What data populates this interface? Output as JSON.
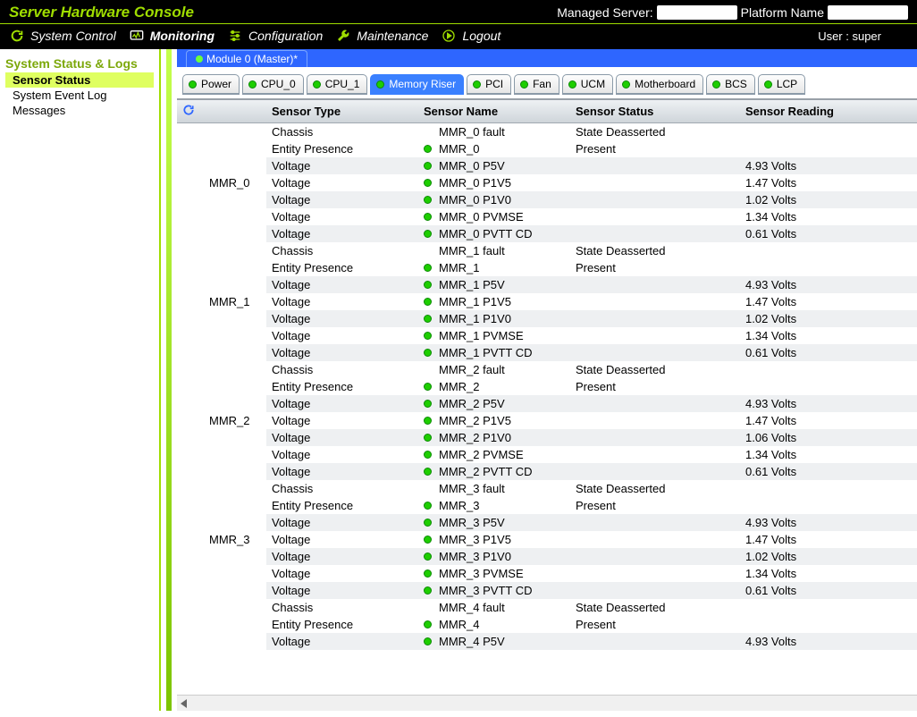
{
  "header": {
    "title": "Server Hardware Console",
    "managed_server_label": "Managed Server:",
    "platform_name_label": "Platform Name"
  },
  "menubar": {
    "items": [
      {
        "label": "System Control",
        "icon": "refresh-icon"
      },
      {
        "label": "Monitoring",
        "icon": "monitor-icon",
        "active": true
      },
      {
        "label": "Configuration",
        "icon": "sliders-icon"
      },
      {
        "label": "Maintenance",
        "icon": "wrench-icon"
      },
      {
        "label": "Logout",
        "icon": "logout-icon"
      }
    ],
    "user_label": "User : super"
  },
  "sidebar": {
    "section_title": "System Status & Logs",
    "items": [
      {
        "label": "Sensor Status",
        "selected": true
      },
      {
        "label": "System Event Log"
      },
      {
        "label": "Messages"
      }
    ]
  },
  "module_tab": "Module 0 (Master)*",
  "category_tabs": [
    {
      "label": "Power"
    },
    {
      "label": "CPU_0"
    },
    {
      "label": "CPU_1"
    },
    {
      "label": "Memory Riser",
      "active": true
    },
    {
      "label": "PCI"
    },
    {
      "label": "Fan"
    },
    {
      "label": "UCM"
    },
    {
      "label": "Motherboard"
    },
    {
      "label": "BCS"
    },
    {
      "label": "LCP"
    }
  ],
  "columns": {
    "c0": "",
    "c1": "Sensor Type",
    "c2": "Sensor Name",
    "c3": "Sensor Status",
    "c4": "Sensor Reading"
  },
  "groups": [
    {
      "name": "MMR_0",
      "rows": [
        {
          "type": "Chassis",
          "name": "MMR_0 fault",
          "status": "State Deasserted",
          "reading": "",
          "led": false,
          "stripe": false
        },
        {
          "type": "Entity Presence",
          "name": "MMR_0",
          "status": "Present",
          "reading": "",
          "led": true,
          "stripe": false
        },
        {
          "type": "Voltage",
          "name": "MMR_0 P5V",
          "status": "",
          "reading": "4.93 Volts",
          "led": true,
          "stripe": true
        },
        {
          "type": "Voltage",
          "name": "MMR_0 P1V5",
          "status": "",
          "reading": "1.47 Volts",
          "led": true,
          "stripe": false
        },
        {
          "type": "Voltage",
          "name": "MMR_0 P1V0",
          "status": "",
          "reading": "1.02 Volts",
          "led": true,
          "stripe": true
        },
        {
          "type": "Voltage",
          "name": "MMR_0 PVMSE",
          "status": "",
          "reading": "1.34 Volts",
          "led": true,
          "stripe": false
        },
        {
          "type": "Voltage",
          "name": "MMR_0 PVTT CD",
          "status": "",
          "reading": "0.61 Volts",
          "led": true,
          "stripe": true
        }
      ]
    },
    {
      "name": "MMR_1",
      "rows": [
        {
          "type": "Chassis",
          "name": "MMR_1 fault",
          "status": "State Deasserted",
          "reading": "",
          "led": false,
          "stripe": false
        },
        {
          "type": "Entity Presence",
          "name": "MMR_1",
          "status": "Present",
          "reading": "",
          "led": true,
          "stripe": false
        },
        {
          "type": "Voltage",
          "name": "MMR_1 P5V",
          "status": "",
          "reading": "4.93 Volts",
          "led": true,
          "stripe": true
        },
        {
          "type": "Voltage",
          "name": "MMR_1 P1V5",
          "status": "",
          "reading": "1.47 Volts",
          "led": true,
          "stripe": false
        },
        {
          "type": "Voltage",
          "name": "MMR_1 P1V0",
          "status": "",
          "reading": "1.02 Volts",
          "led": true,
          "stripe": true
        },
        {
          "type": "Voltage",
          "name": "MMR_1 PVMSE",
          "status": "",
          "reading": "1.34 Volts",
          "led": true,
          "stripe": false
        },
        {
          "type": "Voltage",
          "name": "MMR_1 PVTT CD",
          "status": "",
          "reading": "0.61 Volts",
          "led": true,
          "stripe": true
        }
      ]
    },
    {
      "name": "MMR_2",
      "rows": [
        {
          "type": "Chassis",
          "name": "MMR_2 fault",
          "status": "State Deasserted",
          "reading": "",
          "led": false,
          "stripe": false
        },
        {
          "type": "Entity Presence",
          "name": "MMR_2",
          "status": "Present",
          "reading": "",
          "led": true,
          "stripe": false
        },
        {
          "type": "Voltage",
          "name": "MMR_2 P5V",
          "status": "",
          "reading": "4.93 Volts",
          "led": true,
          "stripe": true
        },
        {
          "type": "Voltage",
          "name": "MMR_2 P1V5",
          "status": "",
          "reading": "1.47 Volts",
          "led": true,
          "stripe": false
        },
        {
          "type": "Voltage",
          "name": "MMR_2 P1V0",
          "status": "",
          "reading": "1.06 Volts",
          "led": true,
          "stripe": true
        },
        {
          "type": "Voltage",
          "name": "MMR_2 PVMSE",
          "status": "",
          "reading": "1.34 Volts",
          "led": true,
          "stripe": false
        },
        {
          "type": "Voltage",
          "name": "MMR_2 PVTT CD",
          "status": "",
          "reading": "0.61 Volts",
          "led": true,
          "stripe": true
        }
      ]
    },
    {
      "name": "MMR_3",
      "rows": [
        {
          "type": "Chassis",
          "name": "MMR_3 fault",
          "status": "State Deasserted",
          "reading": "",
          "led": false,
          "stripe": false
        },
        {
          "type": "Entity Presence",
          "name": "MMR_3",
          "status": "Present",
          "reading": "",
          "led": true,
          "stripe": false
        },
        {
          "type": "Voltage",
          "name": "MMR_3 P5V",
          "status": "",
          "reading": "4.93 Volts",
          "led": true,
          "stripe": true
        },
        {
          "type": "Voltage",
          "name": "MMR_3 P1V5",
          "status": "",
          "reading": "1.47 Volts",
          "led": true,
          "stripe": false
        },
        {
          "type": "Voltage",
          "name": "MMR_3 P1V0",
          "status": "",
          "reading": "1.02 Volts",
          "led": true,
          "stripe": true
        },
        {
          "type": "Voltage",
          "name": "MMR_3 PVMSE",
          "status": "",
          "reading": "1.34 Volts",
          "led": true,
          "stripe": false
        },
        {
          "type": "Voltage",
          "name": "MMR_3 PVTT CD",
          "status": "",
          "reading": "0.61 Volts",
          "led": true,
          "stripe": true
        }
      ]
    },
    {
      "name": "",
      "rows": [
        {
          "type": "Chassis",
          "name": "MMR_4 fault",
          "status": "State Deasserted",
          "reading": "",
          "led": false,
          "stripe": false
        },
        {
          "type": "Entity Presence",
          "name": "MMR_4",
          "status": "Present",
          "reading": "",
          "led": true,
          "stripe": false
        },
        {
          "type": "Voltage",
          "name": "MMR_4 P5V",
          "status": "",
          "reading": "4.93 Volts",
          "led": true,
          "stripe": true
        }
      ]
    }
  ]
}
